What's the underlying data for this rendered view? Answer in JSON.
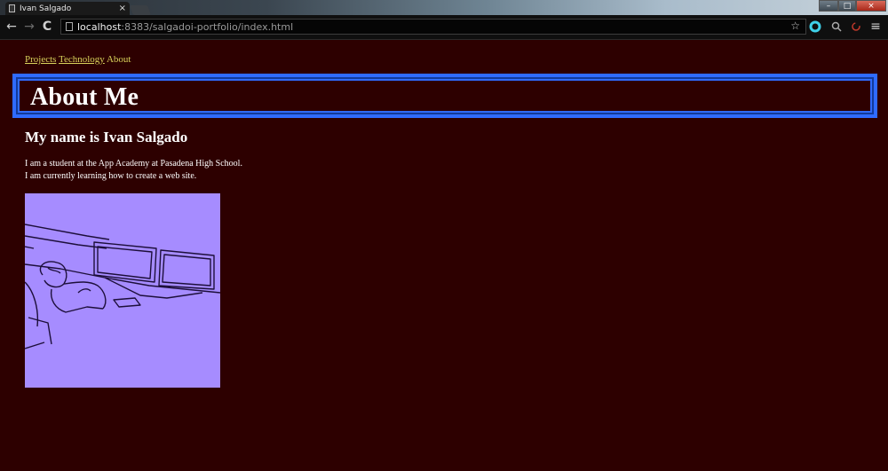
{
  "browser": {
    "tab_title": "Ivan Salgado",
    "tab_close": "×",
    "url_host": "localhost",
    "url_rest": ":8383/salgadoi-portfolio/index.html",
    "back": "←",
    "forward": "→",
    "reload": "C",
    "star": "☆",
    "menu": "≡",
    "win_min": "–",
    "win_max": "□",
    "win_close": "×"
  },
  "nav": {
    "projects": "Projects",
    "technology": "Technology",
    "about": "About"
  },
  "page": {
    "title": "About Me",
    "subtitle": "My name is Ivan Salgado",
    "bio": "I am a student at the App Academy at Pasadena High School. I am currently learning how to create a web site."
  },
  "colors": {
    "background": "#2d0000",
    "link": "#d8d15a",
    "heading_border": "#2f6bff",
    "photo_tint": "#a68cff"
  }
}
